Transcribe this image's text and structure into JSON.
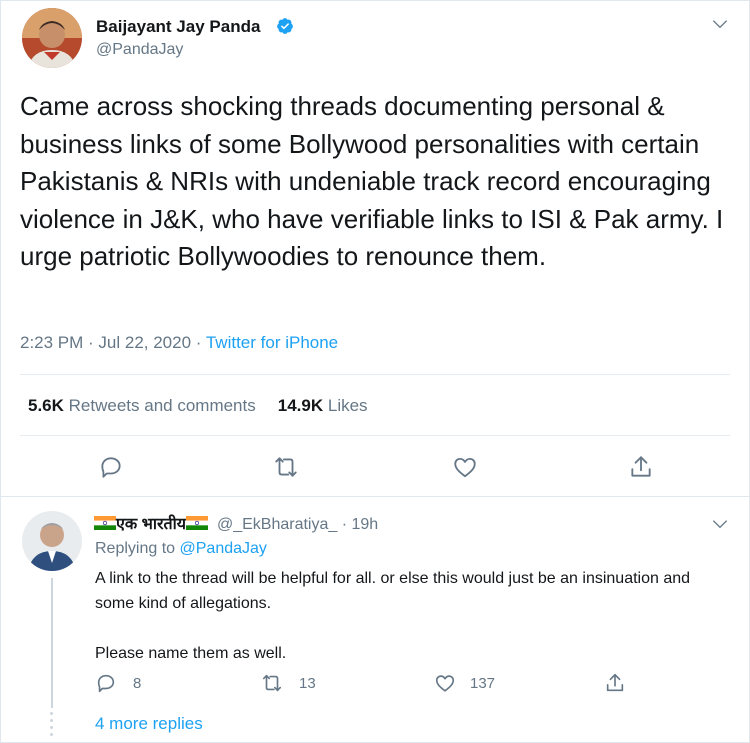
{
  "tweet": {
    "author_name": "Baijayant Jay Panda",
    "author_handle": "@PandaJay",
    "text": "Came across shocking threads documenting personal & business links of some Bollywood personalities with certain Pakistanis & NRIs with undeniable track record encouraging violence in J&K, who have verifiable links to ISI & Pak army. I urge patriotic Bollywoodies to renounce them.",
    "time": "2:23 PM · Jul 22, 2020 · ",
    "source": "Twitter for iPhone",
    "retweets_count": "5.6K",
    "retweets_label": "Retweets and comments",
    "likes_count": "14.9K",
    "likes_label": "Likes",
    "icons": [
      "reply-icon",
      "retweet-icon",
      "like-icon",
      "share-icon",
      "verified-badge-icon",
      "chevron-down-icon"
    ]
  },
  "reply": {
    "display_name": "एक भारतीय",
    "handle": "@_EkBharatiya_",
    "time": " · 19h",
    "replying_prefix": "Replying to ",
    "replying_to": "@PandaJay",
    "paragraphs": [
      "A link to the thread will be helpful for all. or else this would just be an insinuation and some kind of allegations.",
      "Please name them as well."
    ],
    "reply_count": "8",
    "retweet_count": "13",
    "like_count": "137",
    "more_replies": "4 more replies"
  },
  "colors": {
    "accent": "#1da1f2",
    "muted": "#657786",
    "text": "#14171a",
    "divider": "#e6ecf0"
  }
}
